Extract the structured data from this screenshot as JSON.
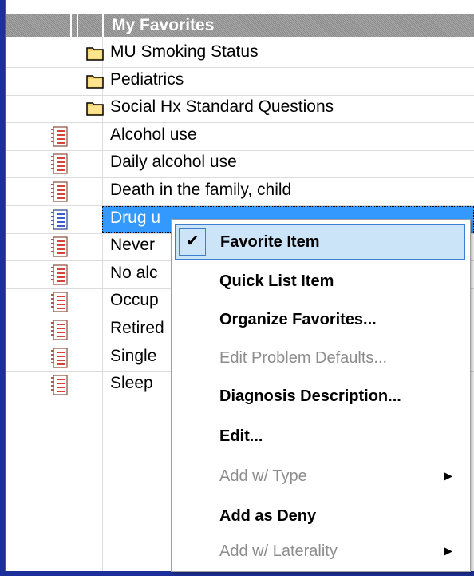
{
  "header": {
    "title": "My Favorites"
  },
  "rows": [
    {
      "label": "MU Smoking Status",
      "icon": "folder-icon"
    },
    {
      "label": "Pediatrics",
      "icon": "folder-icon"
    },
    {
      "label": "Social Hx Standard Questions",
      "icon": "folder-icon"
    },
    {
      "label": "Alcohol use",
      "icon": "list-document-icon"
    },
    {
      "label": "Daily alcohol use",
      "icon": "list-document-icon"
    },
    {
      "label": "Death in the family, child",
      "icon": "list-document-icon"
    },
    {
      "label": "Drug u",
      "icon": "list-document-icon",
      "selected": true
    },
    {
      "label": "Never",
      "icon": "list-document-icon"
    },
    {
      "label": "No alc",
      "icon": "list-document-icon"
    },
    {
      "label": "Occup",
      "icon": "list-document-icon"
    },
    {
      "label": "Retired",
      "icon": "list-document-icon"
    },
    {
      "label": "Single",
      "icon": "list-document-icon"
    },
    {
      "label": "Sleep",
      "icon": "list-document-icon"
    }
  ],
  "context_menu": {
    "items": [
      {
        "label": "Favorite Item",
        "checked": true,
        "enabled": true
      },
      {
        "label": "Quick List Item",
        "enabled": true
      },
      {
        "label": "Organize Favorites...",
        "enabled": true
      },
      {
        "label": "Edit Problem Defaults...",
        "enabled": false
      },
      {
        "label": "Diagnosis Description...",
        "enabled": true
      },
      {
        "label": "Edit...",
        "enabled": true
      },
      {
        "label": "Add w/ Type",
        "enabled": false,
        "submenu": true
      },
      {
        "label": "Add as Deny",
        "enabled": true
      },
      {
        "label": "Add w/ Laterality",
        "enabled": false,
        "submenu": true
      }
    ],
    "check_glyph": "✔",
    "submenu_glyph": "▶"
  },
  "colors": {
    "selection": "#3399ff",
    "menu_highlight": "#cce4f7",
    "menu_highlight_border": "#3c7fd1",
    "disabled_text": "#8d8d8d",
    "frame_blue": "#1c2f9a"
  }
}
